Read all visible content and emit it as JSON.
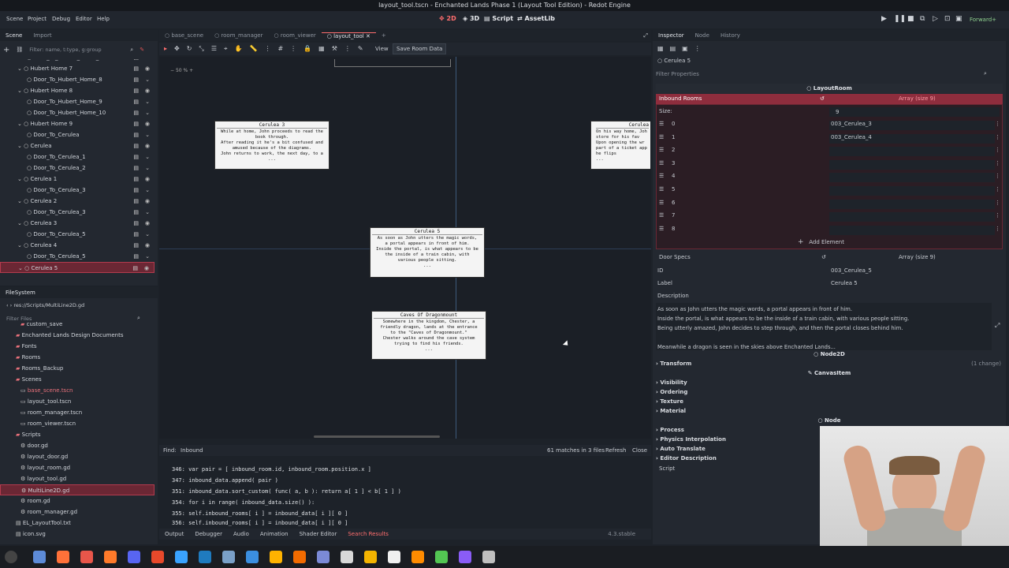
{
  "window": {
    "title": "layout_tool.tscn - Enchanted Lands Phase 1 (Layout Tool Edition) - Redot Engine"
  },
  "menu": {
    "items": [
      "Scene",
      "Project",
      "Debug",
      "Editor",
      "Help"
    ]
  },
  "workspaces": {
    "w2d": "2D",
    "w3d": "3D",
    "script": "Script",
    "assetlib": "AssetLib"
  },
  "renderer": "Forward+",
  "scene_dock": {
    "tabs": [
      "Scene",
      "Import"
    ],
    "filter_placeholder": "Filter: name, t:type, g:group",
    "items": [
      {
        "label": "Door_To_Hubert_Home_6",
        "indent": 2
      },
      {
        "label": "Hubert Home 7",
        "indent": 1
      },
      {
        "label": "Door_To_Hubert_Home_8",
        "indent": 2
      },
      {
        "label": "Hubert Home 8",
        "indent": 1
      },
      {
        "label": "Door_To_Hubert_Home_9",
        "indent": 2
      },
      {
        "label": "Door_To_Hubert_Home_10",
        "indent": 2
      },
      {
        "label": "Hubert Home 9",
        "indent": 1
      },
      {
        "label": "Door_To_Cerulea",
        "indent": 2
      },
      {
        "label": "Cerulea",
        "indent": 1
      },
      {
        "label": "Door_To_Cerulea_1",
        "indent": 2
      },
      {
        "label": "Door_To_Cerulea_2",
        "indent": 2
      },
      {
        "label": "Cerulea 1",
        "indent": 1
      },
      {
        "label": "Door_To_Cerulea_3",
        "indent": 2
      },
      {
        "label": "Cerulea 2",
        "indent": 1
      },
      {
        "label": "Door_To_Cerulea_3",
        "indent": 2
      },
      {
        "label": "Cerulea 3",
        "indent": 1
      },
      {
        "label": "Door_To_Cerulea_5",
        "indent": 2
      },
      {
        "label": "Cerulea 4",
        "indent": 1
      },
      {
        "label": "Door_To_Cerulea_5",
        "indent": 2
      },
      {
        "label": "Cerulea 5",
        "indent": 1
      }
    ]
  },
  "filesystem": {
    "title": "FileSystem",
    "path": "res://Scripts/MultiLine2D.gd",
    "filter_placeholder": "Filter Files",
    "items": [
      {
        "label": "custom_save",
        "type": "folder",
        "indent": 2
      },
      {
        "label": "Enchanted Lands Design Documents",
        "type": "folder",
        "indent": 1
      },
      {
        "label": "Fonts",
        "type": "folder",
        "indent": 1
      },
      {
        "label": "Rooms",
        "type": "folder",
        "indent": 1
      },
      {
        "label": "Rooms_Backup",
        "type": "folder",
        "indent": 1
      },
      {
        "label": "Scenes",
        "type": "folder",
        "indent": 1
      },
      {
        "label": "base_scene.tscn",
        "type": "scene-red",
        "indent": 2
      },
      {
        "label": "layout_tool.tscn",
        "type": "scene",
        "indent": 2
      },
      {
        "label": "room_manager.tscn",
        "type": "scene",
        "indent": 2
      },
      {
        "label": "room_viewer.tscn",
        "type": "scene",
        "indent": 2
      },
      {
        "label": "Scripts",
        "type": "folder",
        "indent": 1
      },
      {
        "label": "door.gd",
        "type": "script",
        "indent": 2
      },
      {
        "label": "layout_door.gd",
        "type": "script",
        "indent": 2
      },
      {
        "label": "layout_room.gd",
        "type": "script",
        "indent": 2
      },
      {
        "label": "layout_tool.gd",
        "type": "script",
        "indent": 2
      },
      {
        "label": "MultiLine2D.gd",
        "type": "script",
        "indent": 2
      },
      {
        "label": "room.gd",
        "type": "script",
        "indent": 2
      },
      {
        "label": "room_manager.gd",
        "type": "script",
        "indent": 2
      },
      {
        "label": "EL_LayoutTool.txt",
        "type": "file",
        "indent": 1
      },
      {
        "label": "icon.svg",
        "type": "file",
        "indent": 1
      }
    ]
  },
  "editor_tabs": [
    "base_scene",
    "room_manager",
    "room_viewer",
    "layout_tool"
  ],
  "toolbar": {
    "view": "View",
    "save_room": "Save Room Data",
    "zoom": "50 %"
  },
  "cards": [
    {
      "title": "Cerulea 3",
      "lines": [
        "While at home, John proceeds to read the",
        "book through.",
        "After reading it he's a bit confused and",
        "amused because of the diagrams.",
        "John returns to work, the next day, to a",
        "..."
      ]
    },
    {
      "title": "Cerulea 5",
      "lines": [
        "As soon as John utters the magic words,",
        "a portal appears in front of him.",
        "Inside the portal, is what appears to be",
        "the inside of a train cabin, with",
        "various people sitting.",
        "..."
      ]
    },
    {
      "title": "Caves Of Dragonmount",
      "lines": [
        "Somewhere in the kingdom, Chester, a",
        "friendly dragon, lands at the entrance",
        "to the \"Caves of Dragonmount.\"",
        "Chester walks around the cave system",
        "trying to find his friends.",
        "..."
      ]
    },
    {
      "title": "Cerulea",
      "lines": [
        "On his way home, Joh",
        "store for his fav",
        "Upon opening the wr",
        "part of a ticket app",
        "he flips",
        "..."
      ]
    }
  ],
  "find_bar": {
    "label": "Find:",
    "query": "Inbound",
    "matches": "61 matches in 3 files",
    "refresh": "Refresh",
    "close": "Close"
  },
  "code_lines": [
    {
      "num": "346:",
      "text": "var pair = [ inbound_room.id, inbound_room.position.x ]"
    },
    {
      "num": "347:",
      "text": "inbound_data.append( pair )"
    },
    {
      "num": "351:",
      "text": "inbound_data.sort_custom( func( a, b ): return a[ 1 ] < b[ 1 ] )"
    },
    {
      "num": "354:",
      "text": "for i in range( inbound_data.size() ):"
    },
    {
      "num": "355:",
      "text": "self.inbound_rooms[ i ] = inbound_data[ i ][ 0 ]"
    },
    {
      "num": "356:",
      "text": "self.inbound_rooms[ i ] = inbound_data[ i ][ 0 ]"
    }
  ],
  "bottom_tabs": [
    "Output",
    "Debugger",
    "Audio",
    "Animation",
    "Shader Editor",
    "Search Results"
  ],
  "version": "4.3.stable",
  "inspector": {
    "tabs": [
      "Inspector",
      "Node",
      "History"
    ],
    "object": "Cerulea 5",
    "filter_placeholder": "Filter Properties",
    "class_header": "LayoutRoom",
    "inbound_label": "Inbound Rooms",
    "inbound_value": "Array (size 9)",
    "size_label": "Size:",
    "size_value": "9",
    "elements": [
      {
        "idx": "0",
        "val": "003_Cerulea_3"
      },
      {
        "idx": "1",
        "val": "003_Cerulea_4"
      },
      {
        "idx": "2",
        "val": ""
      },
      {
        "idx": "3",
        "val": ""
      },
      {
        "idx": "4",
        "val": ""
      },
      {
        "idx": "5",
        "val": ""
      },
      {
        "idx": "6",
        "val": ""
      },
      {
        "idx": "7",
        "val": ""
      },
      {
        "idx": "8",
        "val": ""
      }
    ],
    "add_element": "Add Element",
    "door_specs_label": "Door Specs",
    "door_specs_value": "Array (size 9)",
    "id_label": "ID",
    "id_value": "003_Cerulea_5",
    "label_label": "Label",
    "label_value": "Cerulea 5",
    "desc_label": "Description",
    "desc_lines": [
      "As soon as John utters the magic words, a portal appears in front of him.",
      "Inside the portal, is what appears to be the inside of a train cabin, with various people sitting.",
      "Being utterly amazed, John decides to step through, and then the portal closes behind him.",
      "",
      "Meanwhile a dragon is seen in the skies above Enchanted Lands..."
    ],
    "node2d": "Node2D",
    "transform": "Transform",
    "transform_note": "(1 change)",
    "canvasitem": "CanvasItem",
    "canvas_sections": [
      "Visibility",
      "Ordering",
      "Texture",
      "Material"
    ],
    "node": "Node",
    "node_sections": [
      "Process",
      "Physics Interpolation",
      "Auto Translate",
      "Editor Description"
    ],
    "script_label": "Script"
  },
  "colors": {
    "accent": "#ff6e6e",
    "selection": "#6b2734"
  }
}
